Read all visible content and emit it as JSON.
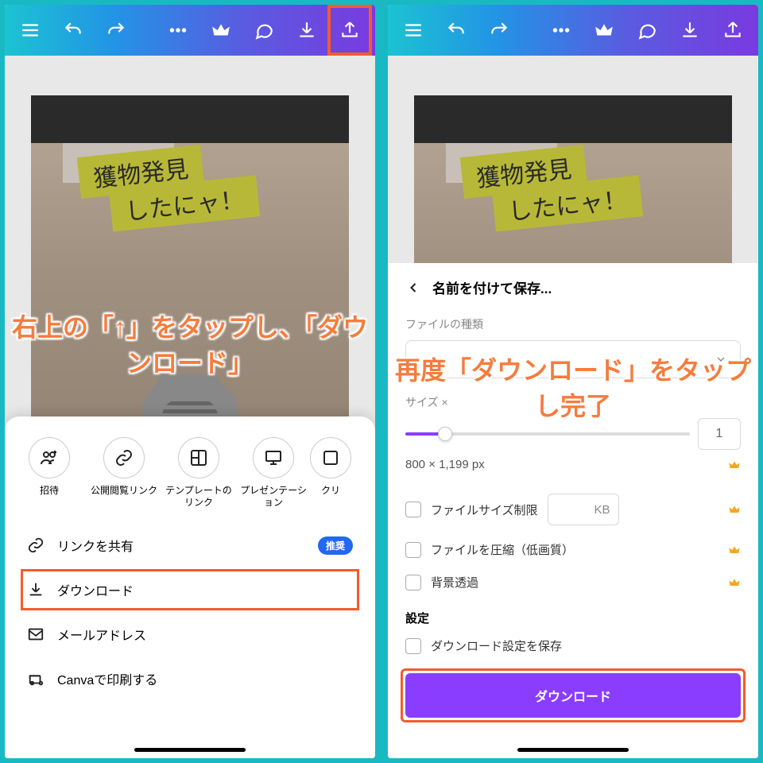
{
  "left": {
    "design": {
      "tag1": "獲物発見",
      "tag2": "したにャ！"
    },
    "annotation": "右上の「↑」をタップし、「ダウンロード」",
    "share_items": [
      {
        "label": "招待"
      },
      {
        "label": "公開閲覧リンク"
      },
      {
        "label": "テンプレートのリンク"
      },
      {
        "label": "プレゼンテーション"
      },
      {
        "label": "クリ"
      }
    ],
    "menu": {
      "share_link": "リンクを共有",
      "share_badge": "推奨",
      "download": "ダウンロード",
      "email": "メールアドレス",
      "print": "Canvaで印刷する"
    }
  },
  "right": {
    "design": {
      "tag1": "獲物発見",
      "tag2": "したにャ！"
    },
    "annotation": "再度「ダウンロード」をタップし完了",
    "sheet": {
      "title": "名前を付けて保存...",
      "file_type_label": "ファイルの種類",
      "size_label": "サイズ ×",
      "size_value": "1",
      "dimensions": "800 × 1,199 px",
      "limit_label": "ファイルサイズ制限",
      "limit_unit": "KB",
      "compress_label": "ファイルを圧縮（低画質）",
      "transparent_label": "背景透過",
      "settings_label": "設定",
      "save_settings_label": "ダウンロード設定を保存",
      "download_btn": "ダウンロード"
    }
  }
}
